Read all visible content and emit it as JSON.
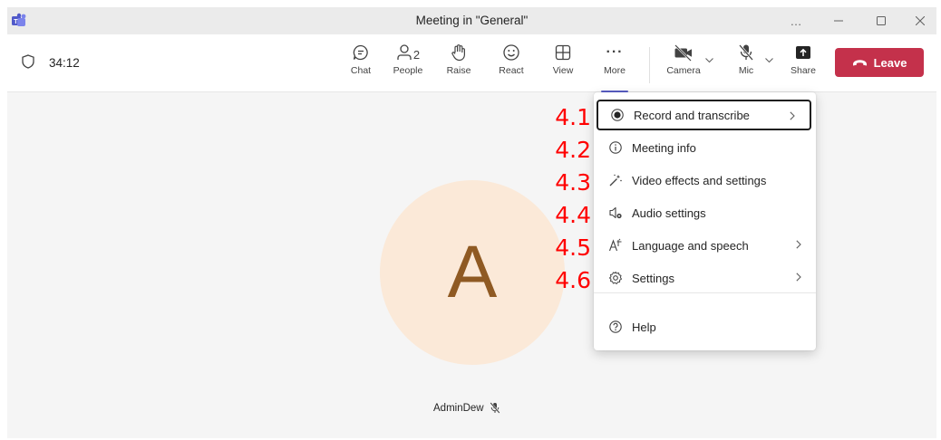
{
  "window": {
    "title": "Meeting in \"General\"",
    "more_label": "…"
  },
  "toolbar": {
    "timer": "34:12",
    "chat_label": "Chat",
    "people_label": "People",
    "people_count": "2",
    "raise_label": "Raise",
    "react_label": "React",
    "view_label": "View",
    "more_dots": "···",
    "more_label": "More",
    "camera_label": "Camera",
    "mic_label": "Mic",
    "share_label": "Share",
    "leave_label": "Leave",
    "leave_color": "#c4314b",
    "accent_color": "#5b5fc7"
  },
  "stage": {
    "avatar_initial": "A",
    "avatar_bg": "#fbe9d8",
    "avatar_fg": "#8f5a23",
    "participant_name": "AdminDew"
  },
  "menu": {
    "items": [
      {
        "label": "Record and transcribe",
        "icon": "record-icon",
        "has_submenu": true
      },
      {
        "label": "Meeting info",
        "icon": "info-icon",
        "has_submenu": false
      },
      {
        "label": "Video effects and settings",
        "icon": "magic-wand-icon",
        "has_submenu": false
      },
      {
        "label": "Audio settings",
        "icon": "speaker-settings-icon",
        "has_submenu": false
      },
      {
        "label": "Language and speech",
        "icon": "language-icon",
        "has_submenu": true
      },
      {
        "label": "Settings",
        "icon": "gear-icon",
        "has_submenu": true
      },
      {
        "label": "Help",
        "icon": "help-icon",
        "has_submenu": false
      }
    ]
  },
  "annotations": [
    "4.1",
    "4.2",
    "4.3",
    "4.4",
    "4.5",
    "4.6"
  ]
}
